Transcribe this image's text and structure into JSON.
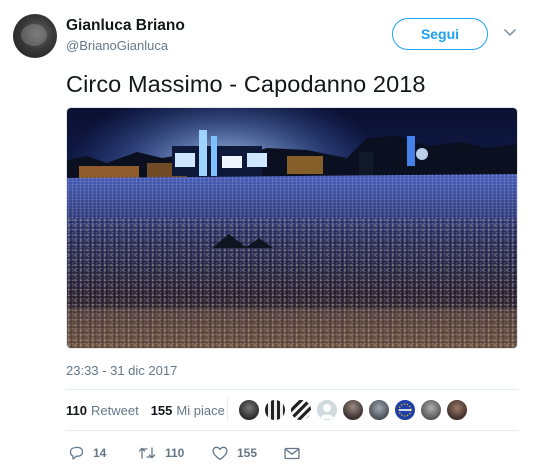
{
  "user": {
    "name": "Gianluca Briano",
    "handle": "@BrianoGianluca",
    "follow_label": "Segui"
  },
  "tweet": {
    "text": "Circo Massimo - Capodanno 2018",
    "timestamp": "23:33 - 31 dic 2017"
  },
  "stats": {
    "retweets": "110",
    "retweets_label": "Retweet",
    "likes": "155",
    "likes_label": "Mi piace"
  },
  "likers": [
    {
      "icon": "avatar-face-dark",
      "color": "#3b3b3b"
    },
    {
      "icon": "avatar-striped",
      "color": "#e8e8e8"
    },
    {
      "icon": "avatar-striped-2",
      "color": "#f2f2f2"
    },
    {
      "icon": "avatar-default",
      "color": "#cfd9de"
    },
    {
      "icon": "avatar-photo",
      "color": "#5a5a5a"
    },
    {
      "icon": "avatar-photo-2",
      "color": "#6d7378"
    },
    {
      "icon": "avatar-eu-flag",
      "color": "#1f3fa6"
    },
    {
      "icon": "avatar-photo-3",
      "color": "#7b7b7b"
    },
    {
      "icon": "avatar-photo-4",
      "color": "#4a3b36"
    }
  ],
  "actions": {
    "replies": "14",
    "retweets": "110",
    "likes": "155"
  },
  "colors": {
    "accent": "#1da1f2",
    "secondary_text": "#657786"
  }
}
